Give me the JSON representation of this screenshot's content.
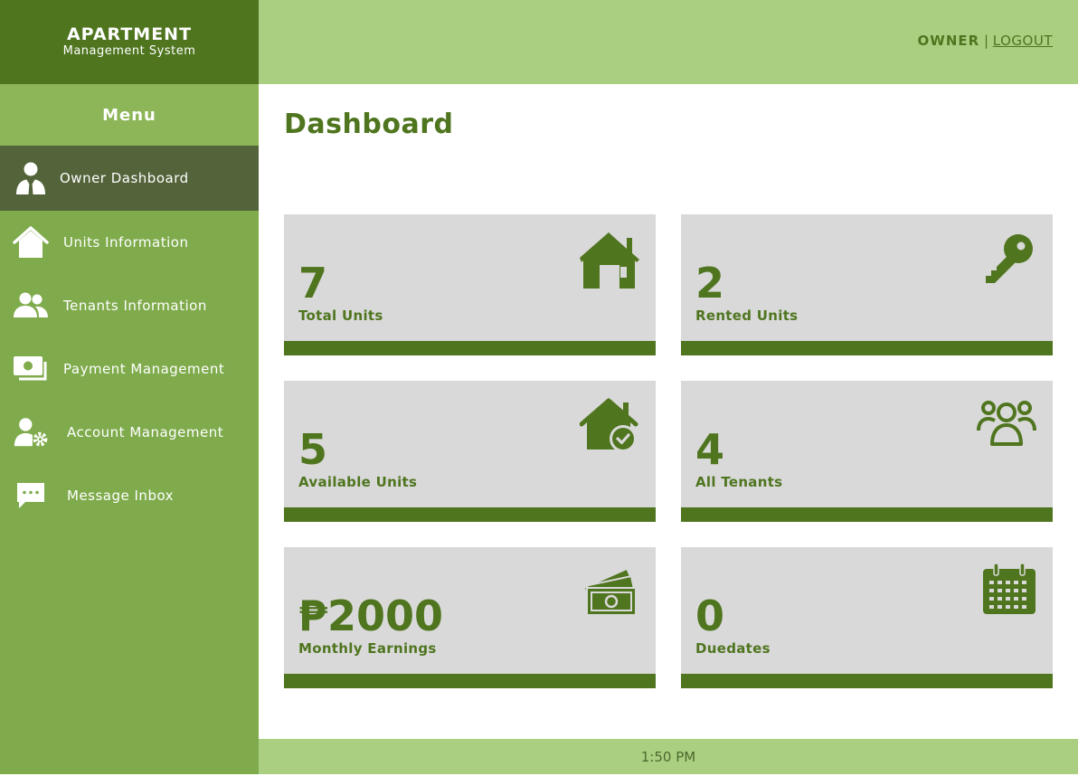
{
  "brand": {
    "title": "APARTMENT",
    "subtitle": "Management System"
  },
  "sidebar": {
    "menu_title": "Menu",
    "items": [
      {
        "label": "Owner Dashboard",
        "icon": "owner-user-icon",
        "active": true
      },
      {
        "label": "Units Information",
        "icon": "house-icon"
      },
      {
        "label": "Tenants Information",
        "icon": "users-icon"
      },
      {
        "label": "Payment Management",
        "icon": "money-icon"
      },
      {
        "label": "Account Management",
        "icon": "user-gear-icon"
      },
      {
        "label": "Message Inbox",
        "icon": "chat-icon"
      }
    ]
  },
  "header": {
    "role": "OWNER",
    "separator": "|",
    "logout": "LOGOUT"
  },
  "main": {
    "title": "Dashboard",
    "cards": [
      {
        "value": "7",
        "label": "Total Units",
        "icon": "house-icon"
      },
      {
        "value": "2",
        "label": "Rented Units",
        "icon": "key-icon"
      },
      {
        "value": "5",
        "label": "Available Units",
        "icon": "house-check-icon"
      },
      {
        "value": "4",
        "label": "All Tenants",
        "icon": "users-icon"
      },
      {
        "value": "₱2000",
        "label": "Monthly Earnings",
        "icon": "money-icon"
      },
      {
        "value": "0",
        "label": "Duedates",
        "icon": "calendar-icon"
      }
    ]
  },
  "footer": {
    "time": "1:50 PM"
  },
  "colors": {
    "dark_green": "#4f751f",
    "sidebar_green": "#7fab4c",
    "light_green": "#abcf81",
    "active_item": "#53633a",
    "card_gray": "#d9d9d9"
  }
}
